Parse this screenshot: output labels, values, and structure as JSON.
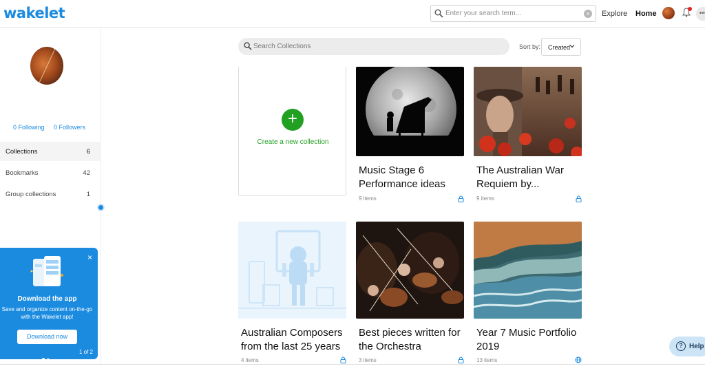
{
  "header": {
    "logo": "wakelet",
    "search_placeholder": "Enter your search term...",
    "clear_glyph": "×",
    "explore": "Explore",
    "home": "Home",
    "more_glyph": "•••"
  },
  "profile": {
    "following": "0 Following",
    "followers": "0 Followers"
  },
  "sidebar": {
    "items": [
      {
        "label": "Collections",
        "count": "6"
      },
      {
        "label": "Bookmarks",
        "count": "42"
      },
      {
        "label": "Group collections",
        "count": "1"
      }
    ]
  },
  "promo": {
    "close": "×",
    "title": "Download the app",
    "description": "Save and organize content on-the-go with the Wakelet app!",
    "button": "Download now",
    "page": "1 of 2"
  },
  "main": {
    "search_placeholder": "Search Collections",
    "sort_label": "Sort by:",
    "sort_value": "Created",
    "create_label": "Create a new collection",
    "plus_glyph": "+"
  },
  "collections": [
    {
      "title": "Music Stage 6 Performance ideas",
      "items": "9 items",
      "privacy": "lock-icon"
    },
    {
      "title": "The Australian War Requiem by...",
      "items": "9 items",
      "privacy": "lock-icon"
    },
    {
      "title": "Australian Composers from the last 25 years",
      "items": "4 items",
      "privacy": "lock-icon"
    },
    {
      "title": "Best pieces written for the Orchestra",
      "items": "3 items",
      "privacy": "lock-icon"
    },
    {
      "title": "Year 7 Music Portfolio 2019",
      "items": "13 items",
      "privacy": "globe-icon"
    }
  ],
  "help": {
    "label": "Help",
    "glyph": "?"
  },
  "colors": {
    "brand": "#1b8be0",
    "create": "#21a021"
  }
}
